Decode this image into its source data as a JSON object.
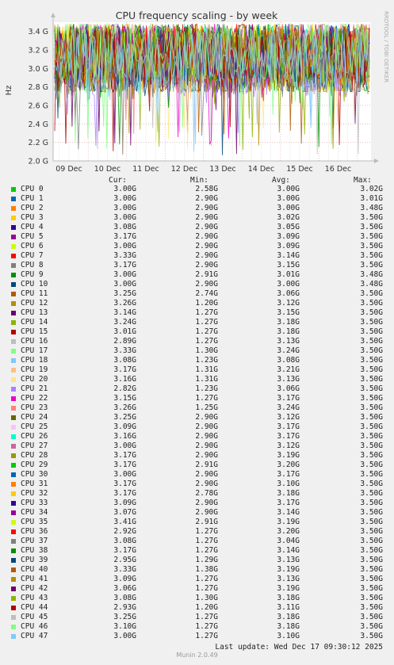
{
  "chart_data": {
    "type": "line",
    "title": "CPU frequency scaling - by week",
    "ylabel": "Hz",
    "side_label": "RRDTOOL / TOBI OETIKER",
    "y_ticks": [
      "2.0 G",
      "2.2 G",
      "2.4 G",
      "2.6 G",
      "2.8 G",
      "3.0 G",
      "3.2 G",
      "3.4 G"
    ],
    "y_tick_values": [
      2.0,
      2.2,
      2.4,
      2.6,
      2.8,
      3.0,
      3.2,
      3.4
    ],
    "ylim": [
      2.0,
      3.5
    ],
    "x_ticks": [
      "09 Dec",
      "10 Dec",
      "11 Dec",
      "12 Dec",
      "13 Dec",
      "14 Dec",
      "15 Dec",
      "16 Dec"
    ],
    "grid": true,
    "columns": [
      "Cur:",
      "Min:",
      "Avg:",
      "Max:"
    ],
    "series": [
      {
        "name": "CPU 0",
        "color": "#00cc00",
        "cur": "3.00G",
        "min": "2.58G",
        "avg": "3.00G",
        "max": "3.02G"
      },
      {
        "name": "CPU 1",
        "color": "#0066b3",
        "cur": "3.00G",
        "min": "2.90G",
        "avg": "3.00G",
        "max": "3.01G"
      },
      {
        "name": "CPU 2",
        "color": "#ff8000",
        "cur": "3.00G",
        "min": "2.90G",
        "avg": "3.00G",
        "max": "3.48G"
      },
      {
        "name": "CPU 3",
        "color": "#ffcc00",
        "cur": "3.00G",
        "min": "2.90G",
        "avg": "3.02G",
        "max": "3.50G"
      },
      {
        "name": "CPU 4",
        "color": "#330099",
        "cur": "3.08G",
        "min": "2.90G",
        "avg": "3.05G",
        "max": "3.50G"
      },
      {
        "name": "CPU 5",
        "color": "#990099",
        "cur": "3.17G",
        "min": "2.90G",
        "avg": "3.09G",
        "max": "3.50G"
      },
      {
        "name": "CPU 6",
        "color": "#ccff00",
        "cur": "3.00G",
        "min": "2.90G",
        "avg": "3.09G",
        "max": "3.50G"
      },
      {
        "name": "CPU 7",
        "color": "#ff0000",
        "cur": "3.33G",
        "min": "2.90G",
        "avg": "3.14G",
        "max": "3.50G"
      },
      {
        "name": "CPU 8",
        "color": "#808080",
        "cur": "3.17G",
        "min": "2.90G",
        "avg": "3.15G",
        "max": "3.50G"
      },
      {
        "name": "CPU 9",
        "color": "#008f00",
        "cur": "3.00G",
        "min": "2.91G",
        "avg": "3.01G",
        "max": "3.48G"
      },
      {
        "name": "CPU 10",
        "color": "#00487d",
        "cur": "3.00G",
        "min": "2.90G",
        "avg": "3.00G",
        "max": "3.48G"
      },
      {
        "name": "CPU 11",
        "color": "#b35a00",
        "cur": "3.25G",
        "min": "2.74G",
        "avg": "3.06G",
        "max": "3.50G"
      },
      {
        "name": "CPU 12",
        "color": "#b38f00",
        "cur": "3.26G",
        "min": "1.20G",
        "avg": "3.12G",
        "max": "3.50G"
      },
      {
        "name": "CPU 13",
        "color": "#6b006b",
        "cur": "3.14G",
        "min": "1.27G",
        "avg": "3.15G",
        "max": "3.50G"
      },
      {
        "name": "CPU 14",
        "color": "#8fb300",
        "cur": "3.24G",
        "min": "1.27G",
        "avg": "3.18G",
        "max": "3.50G"
      },
      {
        "name": "CPU 15",
        "color": "#b30000",
        "cur": "3.01G",
        "min": "1.27G",
        "avg": "3.18G",
        "max": "3.50G"
      },
      {
        "name": "CPU 16",
        "color": "#bebebe",
        "cur": "2.89G",
        "min": "1.27G",
        "avg": "3.13G",
        "max": "3.50G"
      },
      {
        "name": "CPU 17",
        "color": "#80ff80",
        "cur": "3.33G",
        "min": "1.30G",
        "avg": "3.24G",
        "max": "3.50G"
      },
      {
        "name": "CPU 18",
        "color": "#80c9ff",
        "cur": "3.08G",
        "min": "1.23G",
        "avg": "3.08G",
        "max": "3.50G"
      },
      {
        "name": "CPU 19",
        "color": "#ffc080",
        "cur": "3.17G",
        "min": "1.31G",
        "avg": "3.21G",
        "max": "3.50G"
      },
      {
        "name": "CPU 20",
        "color": "#ffe680",
        "cur": "3.16G",
        "min": "1.31G",
        "avg": "3.13G",
        "max": "3.50G"
      },
      {
        "name": "CPU 21",
        "color": "#aa80ff",
        "cur": "2.82G",
        "min": "1.23G",
        "avg": "3.06G",
        "max": "3.50G"
      },
      {
        "name": "CPU 22",
        "color": "#ee00cc",
        "cur": "3.15G",
        "min": "1.27G",
        "avg": "3.17G",
        "max": "3.50G"
      },
      {
        "name": "CPU 23",
        "color": "#ff8080",
        "cur": "3.26G",
        "min": "1.25G",
        "avg": "3.24G",
        "max": "3.50G"
      },
      {
        "name": "CPU 24",
        "color": "#666600",
        "cur": "3.25G",
        "min": "2.90G",
        "avg": "3.12G",
        "max": "3.50G"
      },
      {
        "name": "CPU 25",
        "color": "#ffbfff",
        "cur": "3.09G",
        "min": "2.90G",
        "avg": "3.17G",
        "max": "3.50G"
      },
      {
        "name": "CPU 26",
        "color": "#00ffcc",
        "cur": "3.16G",
        "min": "2.90G",
        "avg": "3.17G",
        "max": "3.50G"
      },
      {
        "name": "CPU 27",
        "color": "#cc6699",
        "cur": "3.00G",
        "min": "2.90G",
        "avg": "3.12G",
        "max": "3.50G"
      },
      {
        "name": "CPU 28",
        "color": "#999900",
        "cur": "3.17G",
        "min": "2.90G",
        "avg": "3.19G",
        "max": "3.50G"
      },
      {
        "name": "CPU 29",
        "color": "#00cc00",
        "cur": "3.17G",
        "min": "2.91G",
        "avg": "3.20G",
        "max": "3.50G"
      },
      {
        "name": "CPU 30",
        "color": "#0066b3",
        "cur": "3.00G",
        "min": "2.90G",
        "avg": "3.17G",
        "max": "3.50G"
      },
      {
        "name": "CPU 31",
        "color": "#ff8000",
        "cur": "3.17G",
        "min": "2.90G",
        "avg": "3.10G",
        "max": "3.50G"
      },
      {
        "name": "CPU 32",
        "color": "#ffcc00",
        "cur": "3.17G",
        "min": "2.78G",
        "avg": "3.18G",
        "max": "3.50G"
      },
      {
        "name": "CPU 33",
        "color": "#330099",
        "cur": "3.09G",
        "min": "2.90G",
        "avg": "3.17G",
        "max": "3.50G"
      },
      {
        "name": "CPU 34",
        "color": "#990099",
        "cur": "3.07G",
        "min": "2.90G",
        "avg": "3.14G",
        "max": "3.50G"
      },
      {
        "name": "CPU 35",
        "color": "#ccff00",
        "cur": "3.41G",
        "min": "2.91G",
        "avg": "3.19G",
        "max": "3.50G"
      },
      {
        "name": "CPU 36",
        "color": "#ff0000",
        "cur": "2.92G",
        "min": "1.27G",
        "avg": "3.20G",
        "max": "3.50G"
      },
      {
        "name": "CPU 37",
        "color": "#808080",
        "cur": "3.08G",
        "min": "1.27G",
        "avg": "3.04G",
        "max": "3.50G"
      },
      {
        "name": "CPU 38",
        "color": "#008f00",
        "cur": "3.17G",
        "min": "1.27G",
        "avg": "3.14G",
        "max": "3.50G"
      },
      {
        "name": "CPU 39",
        "color": "#00487d",
        "cur": "2.95G",
        "min": "1.29G",
        "avg": "3.13G",
        "max": "3.50G"
      },
      {
        "name": "CPU 40",
        "color": "#b35a00",
        "cur": "3.33G",
        "min": "1.38G",
        "avg": "3.19G",
        "max": "3.50G"
      },
      {
        "name": "CPU 41",
        "color": "#b38f00",
        "cur": "3.09G",
        "min": "1.27G",
        "avg": "3.13G",
        "max": "3.50G"
      },
      {
        "name": "CPU 42",
        "color": "#6b006b",
        "cur": "3.06G",
        "min": "1.27G",
        "avg": "3.19G",
        "max": "3.50G"
      },
      {
        "name": "CPU 43",
        "color": "#8fb300",
        "cur": "3.08G",
        "min": "1.30G",
        "avg": "3.18G",
        "max": "3.50G"
      },
      {
        "name": "CPU 44",
        "color": "#b30000",
        "cur": "2.93G",
        "min": "1.20G",
        "avg": "3.11G",
        "max": "3.50G"
      },
      {
        "name": "CPU 45",
        "color": "#bebebe",
        "cur": "3.25G",
        "min": "1.27G",
        "avg": "3.18G",
        "max": "3.50G"
      },
      {
        "name": "CPU 46",
        "color": "#80ff80",
        "cur": "3.10G",
        "min": "1.27G",
        "avg": "3.18G",
        "max": "3.50G"
      },
      {
        "name": "CPU 47",
        "color": "#80c9ff",
        "cur": "3.00G",
        "min": "1.27G",
        "avg": "3.10G",
        "max": "3.50G"
      }
    ]
  },
  "footer": {
    "last_update": "Last update: Wed Dec 17 09:30:12 2025",
    "munin": "Munin 2.0.49"
  }
}
